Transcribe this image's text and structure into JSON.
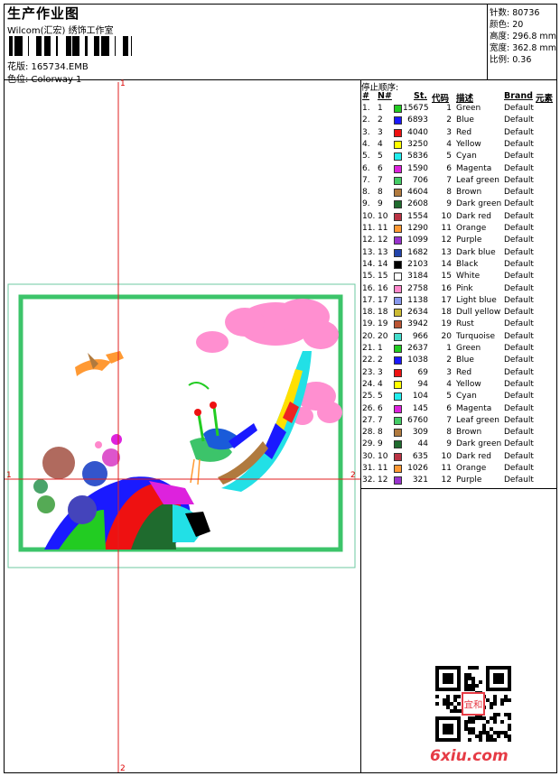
{
  "header": {
    "title": "生产作业图",
    "company": "Wilcom(汇宏) 绣饰工作室",
    "pattern": "花版: 165734.EMB",
    "colorway": "色位: Colorway 1"
  },
  "stats": [
    "针数: 80736",
    "颜色: 20",
    "高度: 296.8 mm",
    "宽度: 362.8 mm",
    "比例: 0.36"
  ],
  "stop_sequence": {
    "title": "停止顺序:",
    "columns": [
      "#",
      "N#",
      "St.",
      "代码",
      "描述",
      "Brand",
      "元素"
    ],
    "rows": [
      {
        "idx": "1.",
        "n": "1",
        "color": "#22cc22",
        "st": "15675",
        "code": "1",
        "desc": "Green",
        "brand": "Default"
      },
      {
        "idx": "2.",
        "n": "2",
        "color": "#1a1aff",
        "st": "6893",
        "code": "2",
        "desc": "Blue",
        "brand": "Default"
      },
      {
        "idx": "3.",
        "n": "3",
        "color": "#ee1111",
        "st": "4040",
        "code": "3",
        "desc": "Red",
        "brand": "Default"
      },
      {
        "idx": "4.",
        "n": "4",
        "color": "#ffff00",
        "st": "3250",
        "code": "4",
        "desc": "Yellow",
        "brand": "Default"
      },
      {
        "idx": "5.",
        "n": "5",
        "color": "#22eeee",
        "st": "5836",
        "code": "5",
        "desc": "Cyan",
        "brand": "Default"
      },
      {
        "idx": "6.",
        "n": "6",
        "color": "#dd22dd",
        "st": "1590",
        "code": "6",
        "desc": "Magenta",
        "brand": "Default"
      },
      {
        "idx": "7.",
        "n": "7",
        "color": "#44cc66",
        "st": "706",
        "code": "7",
        "desc": "Leaf green",
        "brand": "Default"
      },
      {
        "idx": "8.",
        "n": "8",
        "color": "#b07a3e",
        "st": "4604",
        "code": "8",
        "desc": "Brown",
        "brand": "Default"
      },
      {
        "idx": "9.",
        "n": "9",
        "color": "#1f6b2e",
        "st": "2608",
        "code": "9",
        "desc": "Dark green",
        "brand": "Default"
      },
      {
        "idx": "10.",
        "n": "10",
        "color": "#bb3344",
        "st": "1554",
        "code": "10",
        "desc": "Dark red",
        "brand": "Default"
      },
      {
        "idx": "11.",
        "n": "11",
        "color": "#ff9933",
        "st": "1290",
        "code": "11",
        "desc": "Orange",
        "brand": "Default"
      },
      {
        "idx": "12.",
        "n": "12",
        "color": "#9933cc",
        "st": "1099",
        "code": "12",
        "desc": "Purple",
        "brand": "Default"
      },
      {
        "idx": "13.",
        "n": "13",
        "color": "#2244aa",
        "st": "1682",
        "code": "13",
        "desc": "Dark blue",
        "brand": "Default"
      },
      {
        "idx": "14.",
        "n": "14",
        "color": "#000000",
        "st": "2103",
        "code": "14",
        "desc": "Black",
        "brand": "Default"
      },
      {
        "idx": "15.",
        "n": "15",
        "color": "#ffffff",
        "st": "3184",
        "code": "15",
        "desc": "White",
        "brand": "Default"
      },
      {
        "idx": "16.",
        "n": "16",
        "color": "#ff88cc",
        "st": "2758",
        "code": "16",
        "desc": "Pink",
        "brand": "Default"
      },
      {
        "idx": "17.",
        "n": "17",
        "color": "#8899ee",
        "st": "1138",
        "code": "17",
        "desc": "Light blue",
        "brand": "Default"
      },
      {
        "idx": "18.",
        "n": "18",
        "color": "#ccbb33",
        "st": "2634",
        "code": "18",
        "desc": "Dull yellow",
        "brand": "Default"
      },
      {
        "idx": "19.",
        "n": "19",
        "color": "#bb5533",
        "st": "3942",
        "code": "19",
        "desc": "Rust",
        "brand": "Default"
      },
      {
        "idx": "20.",
        "n": "20",
        "color": "#44ddcc",
        "st": "966",
        "code": "20",
        "desc": "Turquoise",
        "brand": "Default"
      },
      {
        "idx": "21.",
        "n": "1",
        "color": "#22cc22",
        "st": "2637",
        "code": "1",
        "desc": "Green",
        "brand": "Default"
      },
      {
        "idx": "22.",
        "n": "2",
        "color": "#1a1aff",
        "st": "1038",
        "code": "2",
        "desc": "Blue",
        "brand": "Default"
      },
      {
        "idx": "23.",
        "n": "3",
        "color": "#ee1111",
        "st": "69",
        "code": "3",
        "desc": "Red",
        "brand": "Default"
      },
      {
        "idx": "24.",
        "n": "4",
        "color": "#ffff00",
        "st": "94",
        "code": "4",
        "desc": "Yellow",
        "brand": "Default"
      },
      {
        "idx": "25.",
        "n": "5",
        "color": "#22eeee",
        "st": "104",
        "code": "5",
        "desc": "Cyan",
        "brand": "Default"
      },
      {
        "idx": "26.",
        "n": "6",
        "color": "#dd22dd",
        "st": "145",
        "code": "6",
        "desc": "Magenta",
        "brand": "Default"
      },
      {
        "idx": "27.",
        "n": "7",
        "color": "#44cc66",
        "st": "6760",
        "code": "7",
        "desc": "Leaf green",
        "brand": "Default"
      },
      {
        "idx": "28.",
        "n": "8",
        "color": "#b07a3e",
        "st": "309",
        "code": "8",
        "desc": "Brown",
        "brand": "Default"
      },
      {
        "idx": "29.",
        "n": "9",
        "color": "#1f6b2e",
        "st": "44",
        "code": "9",
        "desc": "Dark green",
        "brand": "Default"
      },
      {
        "idx": "30.",
        "n": "10",
        "color": "#bb3344",
        "st": "635",
        "code": "10",
        "desc": "Dark red",
        "brand": "Default"
      },
      {
        "idx": "31.",
        "n": "11",
        "color": "#ff9933",
        "st": "1026",
        "code": "11",
        "desc": "Orange",
        "brand": "Default"
      },
      {
        "idx": "32.",
        "n": "12",
        "color": "#9933cc",
        "st": "321",
        "code": "12",
        "desc": "Purple",
        "brand": "Default"
      }
    ]
  },
  "canvas": {
    "guide_labels": {
      "top": "1",
      "bottom": "2",
      "left": "1",
      "right": "2"
    },
    "frame_color": "#3cc46a",
    "guide_color": "#e02020"
  },
  "watermark": "6xiu.com",
  "qr_badge": "宜和"
}
